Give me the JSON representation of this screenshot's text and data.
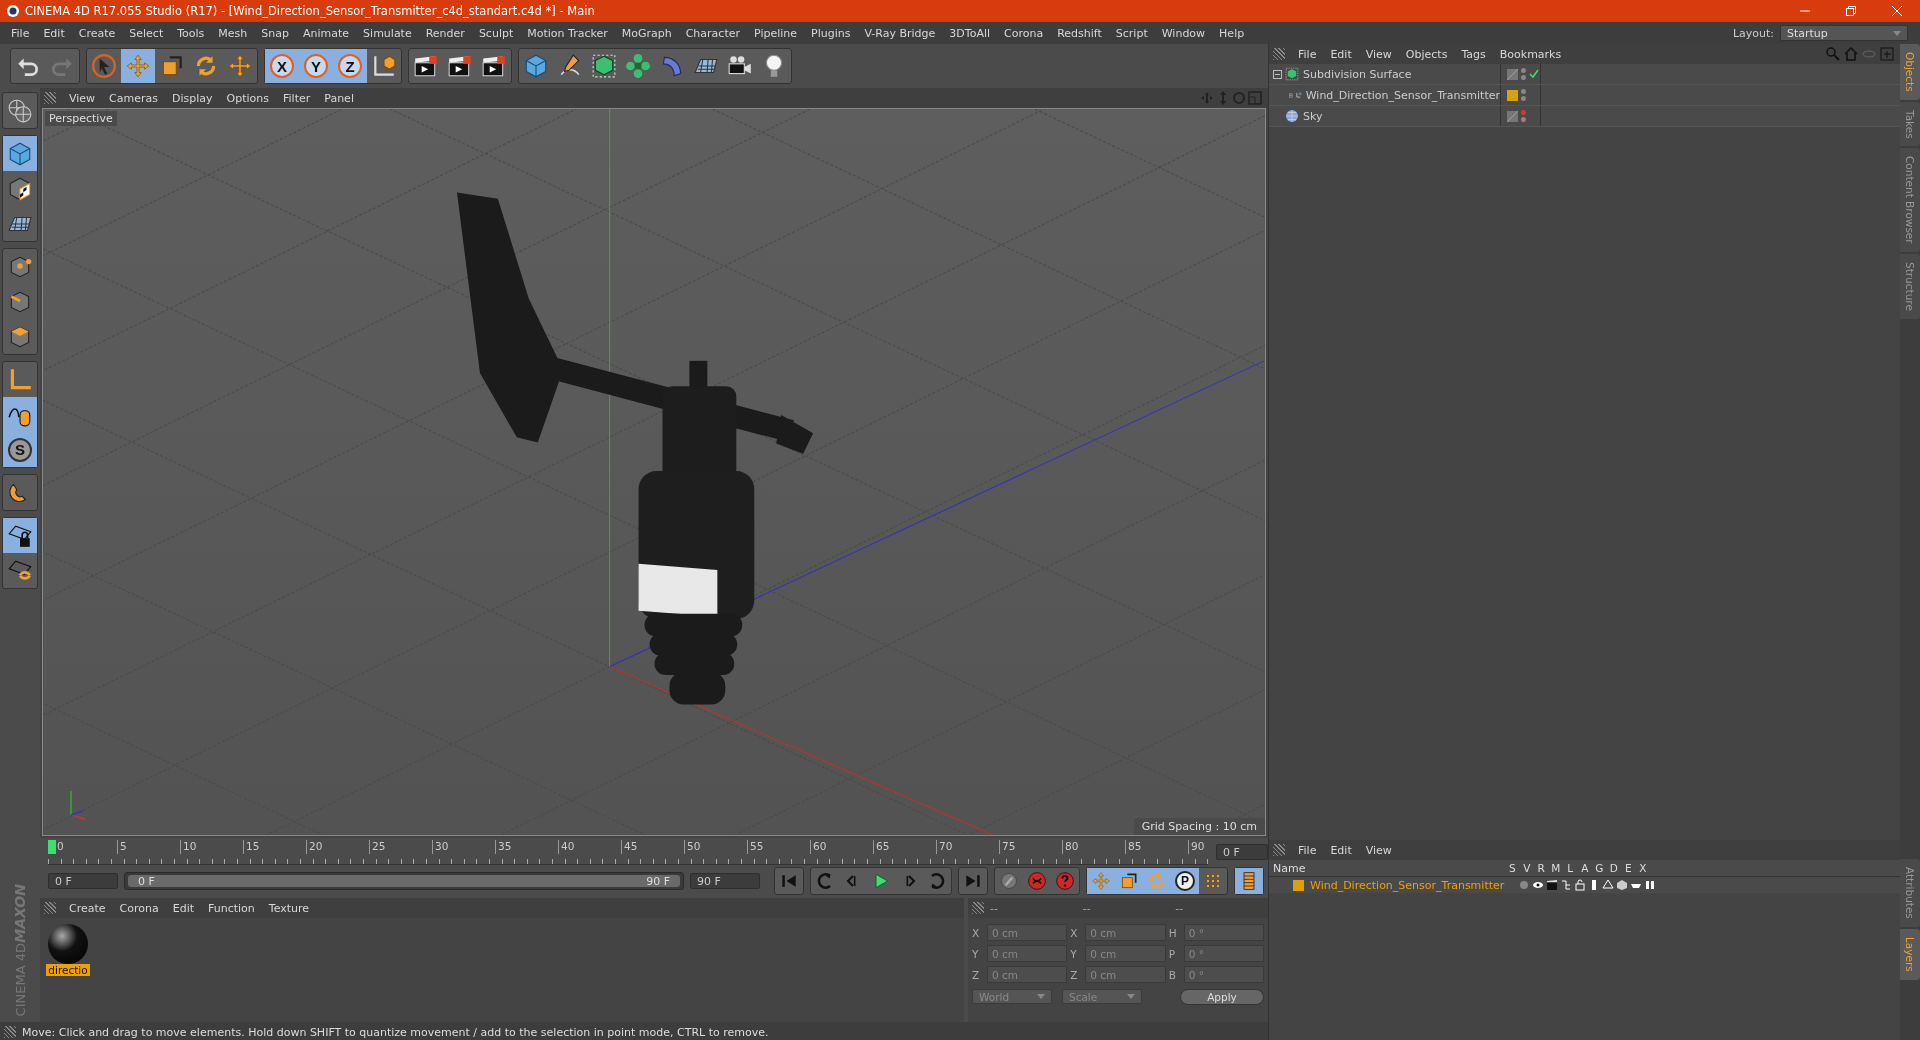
{
  "window": {
    "title": "CINEMA 4D R17.055 Studio (R17) - [Wind_Direction_Sensor_Transmitter_c4d_standart.c4d *] - Main"
  },
  "menu": [
    "File",
    "Edit",
    "Create",
    "Select",
    "Tools",
    "Mesh",
    "Snap",
    "Animate",
    "Simulate",
    "Render",
    "Sculpt",
    "Motion Tracker",
    "MoGraph",
    "Character",
    "Pipeline",
    "Plugins",
    "V-Ray Bridge",
    "3DToAll",
    "Corona",
    "Redshift",
    "Script",
    "Window",
    "Help"
  ],
  "layout": {
    "label": "Layout:",
    "value": "Startup"
  },
  "toolbar": [
    {
      "kind": "undo",
      "selected": false
    },
    {
      "kind": "redo",
      "selected": false
    },
    {
      "kind": "select",
      "selected": false
    },
    {
      "kind": "move",
      "selected": true
    },
    {
      "kind": "scale",
      "selected": false
    },
    {
      "kind": "rotate",
      "selected": false
    },
    {
      "kind": "move",
      "selected": false
    },
    {
      "kind": "axis",
      "label": "X",
      "selected": true
    },
    {
      "kind": "axis",
      "label": "Y",
      "selected": true
    },
    {
      "kind": "axis",
      "label": "Z",
      "selected": true
    },
    {
      "kind": "coord",
      "selected": false
    },
    {
      "kind": "render",
      "selected": false
    },
    {
      "kind": "render",
      "selected": false
    },
    {
      "kind": "render",
      "selected": false
    },
    {
      "kind": "cube",
      "selected": false
    },
    {
      "kind": "pen",
      "selected": false
    },
    {
      "kind": "subdiv",
      "selected": false
    },
    {
      "kind": "cloner",
      "selected": false
    },
    {
      "kind": "deformer",
      "selected": false
    },
    {
      "kind": "floor",
      "selected": false
    },
    {
      "kind": "camera",
      "selected": false
    },
    {
      "kind": "light",
      "selected": false
    }
  ],
  "left_tools": [
    {
      "kind": "model",
      "selected": false
    },
    {
      "kind": "object",
      "selected": true
    },
    {
      "kind": "texture",
      "selected": false
    },
    {
      "kind": "workplane",
      "selected": false
    },
    {
      "kind": "points",
      "selected": false
    },
    {
      "kind": "edges",
      "selected": false
    },
    {
      "kind": "polygons",
      "selected": false
    },
    {
      "kind": "axes",
      "selected": false
    },
    {
      "kind": "tweak",
      "selected": true
    },
    {
      "kind": "soft",
      "label": "S",
      "selected": true
    },
    {
      "kind": "snap",
      "selected": false
    },
    {
      "kind": "lock",
      "selected": true
    },
    {
      "kind": "solo",
      "selected": false
    }
  ],
  "viewport": {
    "menu": [
      "View",
      "Cameras",
      "Display",
      "Options",
      "Filter",
      "Panel"
    ],
    "camera": "Perspective",
    "grid_spacing": "Grid Spacing : 10 cm"
  },
  "timeline": {
    "ticks": [
      "0",
      "5",
      "10",
      "15",
      "20",
      "25",
      "30",
      "35",
      "40",
      "45",
      "50",
      "55",
      "60",
      "65",
      "70",
      "75",
      "80",
      "85",
      "90"
    ],
    "playhead": {
      "level": 0
    },
    "current_frame": "0 F",
    "start_field": "0 F",
    "range_start": "0 F",
    "range_end": "90 F",
    "range_bar": {
      "level": 1
    },
    "end_field": "90 F"
  },
  "transport": [
    {
      "kind": "first"
    },
    {
      "kind": "prev-key"
    },
    {
      "kind": "prev-frame"
    },
    {
      "kind": "play"
    },
    {
      "kind": "next-frame"
    },
    {
      "kind": "next-key"
    },
    {
      "kind": "last"
    }
  ],
  "record": [
    {
      "kind": "keys"
    },
    {
      "kind": "autokey"
    },
    {
      "kind": "help"
    }
  ],
  "key_modes": [
    {
      "kind": "move",
      "selected": true
    },
    {
      "kind": "scale",
      "selected": true
    },
    {
      "kind": "rotate",
      "selected": true
    },
    {
      "kind": "param",
      "label": "P",
      "selected": true
    },
    {
      "kind": "points",
      "selected": false
    }
  ],
  "timeline_button": {
    "selected": true
  },
  "materials": {
    "menu": [
      "Create",
      "Corona",
      "Edit",
      "Function",
      "Texture"
    ],
    "items": [
      {
        "name": "directio",
        "selected": true
      }
    ]
  },
  "coordinates": {
    "headers": [
      "--",
      "--",
      "--"
    ],
    "rows": [
      {
        "axis": "X",
        "position": "0 cm",
        "size_axis": "X",
        "size": "0 cm",
        "rot_axis": "H",
        "rotation": "0 °"
      },
      {
        "axis": "Y",
        "position": "0 cm",
        "size_axis": "Y",
        "size": "0 cm",
        "rot_axis": "P",
        "rotation": "0 °"
      },
      {
        "axis": "Z",
        "position": "0 cm",
        "size_axis": "Z",
        "size": "0 cm",
        "rot_axis": "B",
        "rotation": "0 °"
      }
    ],
    "space": "World",
    "mode": "Scale",
    "apply": "Apply"
  },
  "objects": {
    "menu": [
      "File",
      "Edit",
      "View",
      "Objects",
      "Tags",
      "Bookmarks"
    ],
    "tree": [
      {
        "name": "Subdivision Surface",
        "kind": "subdiv",
        "enabled": true,
        "expanded": true,
        "hidden": false,
        "children": [
          {
            "name": "Wind_Direction_Sensor_Transmitter",
            "kind": "null",
            "color": "#d9a10c",
            "expanded": false,
            "hidden": false
          }
        ]
      },
      {
        "name": "Sky",
        "kind": "sky",
        "hidden": true
      }
    ]
  },
  "layers": {
    "menu": [
      "File",
      "Edit",
      "View"
    ],
    "columns": [
      "Name",
      "S",
      "V",
      "R",
      "M",
      "L",
      "A",
      "G",
      "D",
      "E",
      "X"
    ],
    "rows": [
      {
        "name": "Wind_Direction_Sensor_Transmitter",
        "color": "#d9a10c"
      }
    ]
  },
  "side_tabs_top": [
    {
      "label": "Objects",
      "selected": true
    },
    {
      "label": "Takes",
      "selected": false
    },
    {
      "label": "Content Browser",
      "selected": false
    },
    {
      "label": "Structure",
      "selected": false
    }
  ],
  "side_tabs_bottom": [
    {
      "label": "Attributes",
      "selected": false
    },
    {
      "label": "Layers",
      "selected": true
    }
  ],
  "logo": {
    "brand": "MAXON",
    "product": "CINEMA 4D"
  },
  "status": "Move: Click and drag to move elements. Hold down SHIFT to quantize movement / add to the selection in point mode, CTRL to remove."
}
